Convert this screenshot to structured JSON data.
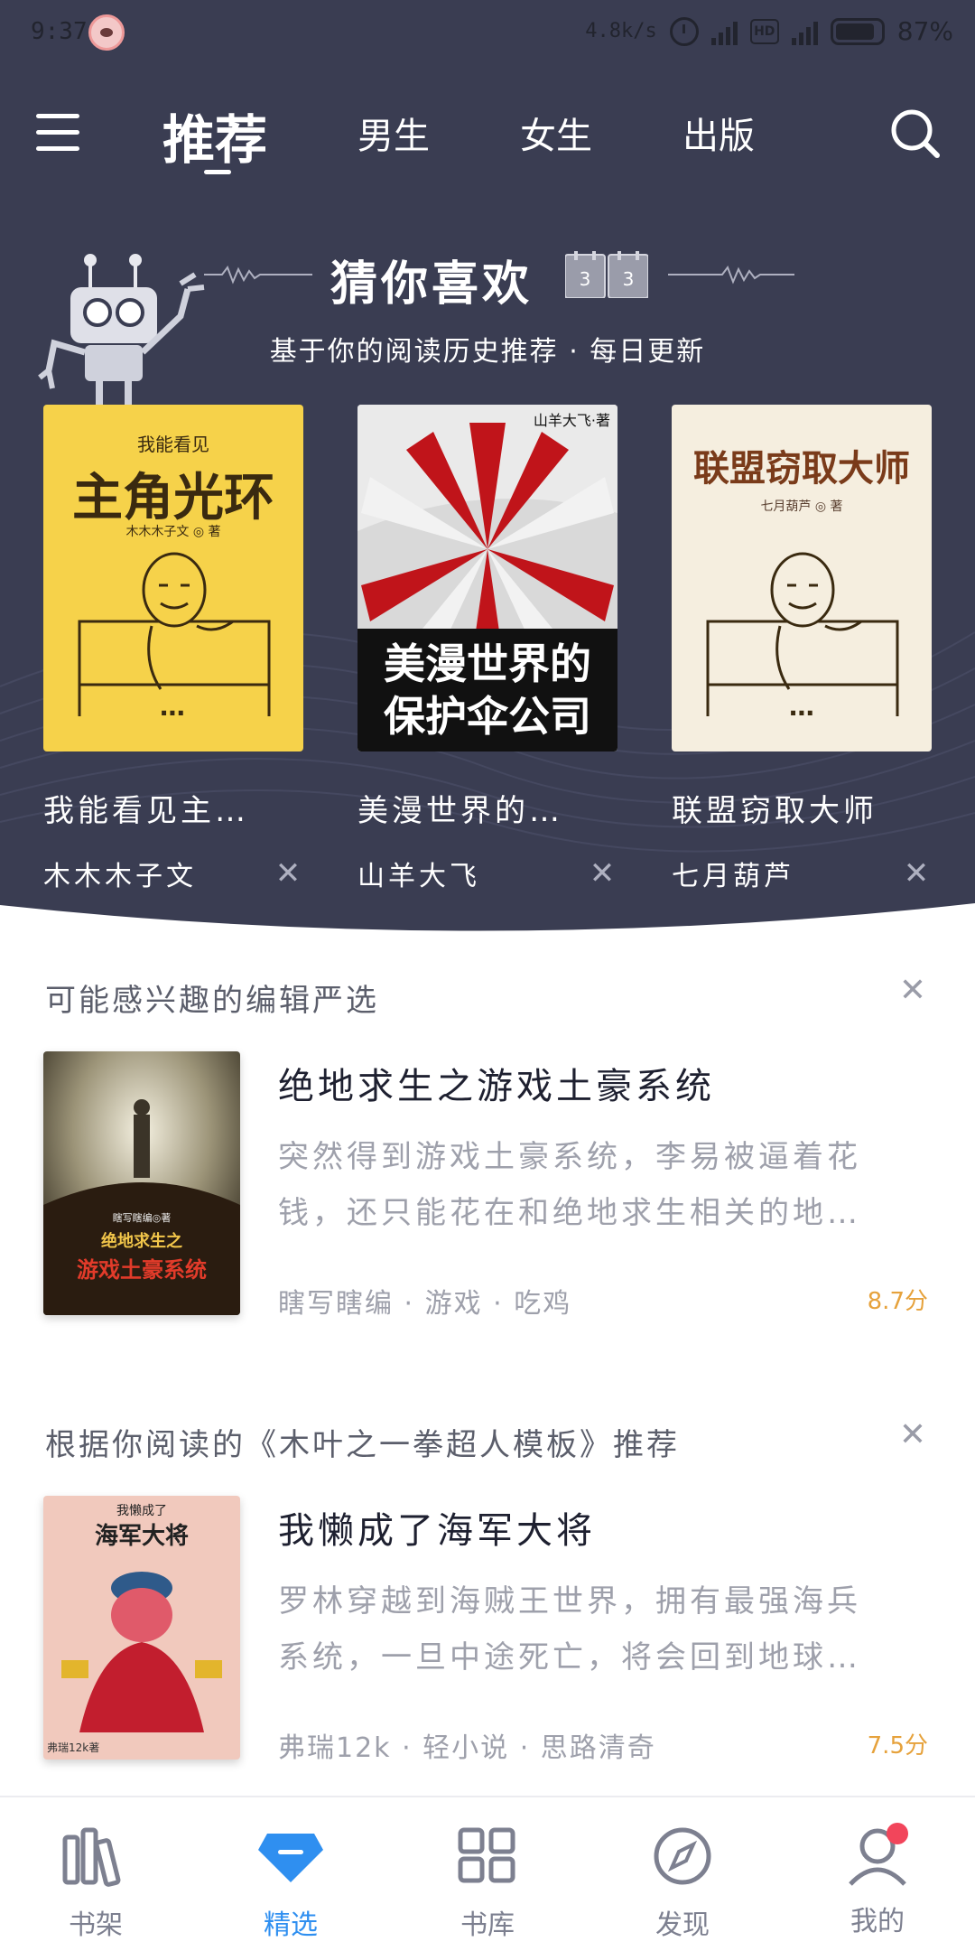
{
  "status_bar": {
    "time": "9:37",
    "net_speed": "4.8k/s",
    "battery": "87%"
  },
  "top_nav": {
    "tabs": [
      {
        "label": "推荐",
        "active": true
      },
      {
        "label": "男生",
        "active": false
      },
      {
        "label": "女生",
        "active": false
      },
      {
        "label": "出版",
        "active": false
      }
    ]
  },
  "guess": {
    "title": "猜你喜欢",
    "subtitle": "基于你的阅读历史推荐 · 每日更新",
    "calendar_days": [
      "3",
      "3"
    ],
    "books": [
      {
        "title": "我能看见主…",
        "author": "木木木子文",
        "cover_top": "我能看见",
        "cover_main": "主角光环",
        "cover_author": "木木木子文 ◎ 著"
      },
      {
        "title": "美漫世界的…",
        "author": "山羊大飞",
        "cover_top": "山羊大飞·著",
        "cover_main": "美漫世界的保护伞公司",
        "cover_author": ""
      },
      {
        "title": "联盟窃取大师",
        "author": "七月葫芦",
        "cover_top": "",
        "cover_main": "联盟窃取大师",
        "cover_author": "七月葫芦 ◎ 著"
      }
    ]
  },
  "sections": [
    {
      "heading": "可能感兴趣的编辑严选",
      "book": {
        "title": "绝地求生之游戏土豪系统",
        "desc_line1": "突然得到游戏土豪系统，李易被逼着花",
        "desc_line2": "钱，还只能花在和绝地求生相关的地…",
        "meta": "瞎写瞎编 · 游戏 · 吃鸡",
        "score": "8.7分",
        "cover_top": "瞎写瞎编◎著",
        "cover_mid": "绝地求生之",
        "cover_main": "游戏土豪系统"
      }
    },
    {
      "heading": "根据你阅读的《木叶之一拳超人模板》推荐",
      "book": {
        "title": "我懒成了海军大将",
        "desc_line1": "罗林穿越到海贼王世界，拥有最强海兵",
        "desc_line2": "系统，一旦中途死亡，将会回到地球…",
        "meta": "弗瑞12k · 轻小说 · 思路清奇",
        "score": "7.5分",
        "cover_top": "我懒成了",
        "cover_main": "海军大将",
        "cover_author": "弗瑞12k著"
      }
    }
  ],
  "bottom_nav": [
    {
      "label": "书架",
      "icon": "bookshelf-icon",
      "active": false
    },
    {
      "label": "精选",
      "icon": "diamond-icon",
      "active": true
    },
    {
      "label": "书库",
      "icon": "grid-icon",
      "active": false
    },
    {
      "label": "发现",
      "icon": "compass-icon",
      "active": false
    },
    {
      "label": "我的",
      "icon": "profile-icon",
      "active": false
    }
  ],
  "colors": {
    "header_bg": "#3a3d52",
    "accent": "#2f8ff0",
    "score": "#e6a23c",
    "badge": "#f2455b"
  }
}
